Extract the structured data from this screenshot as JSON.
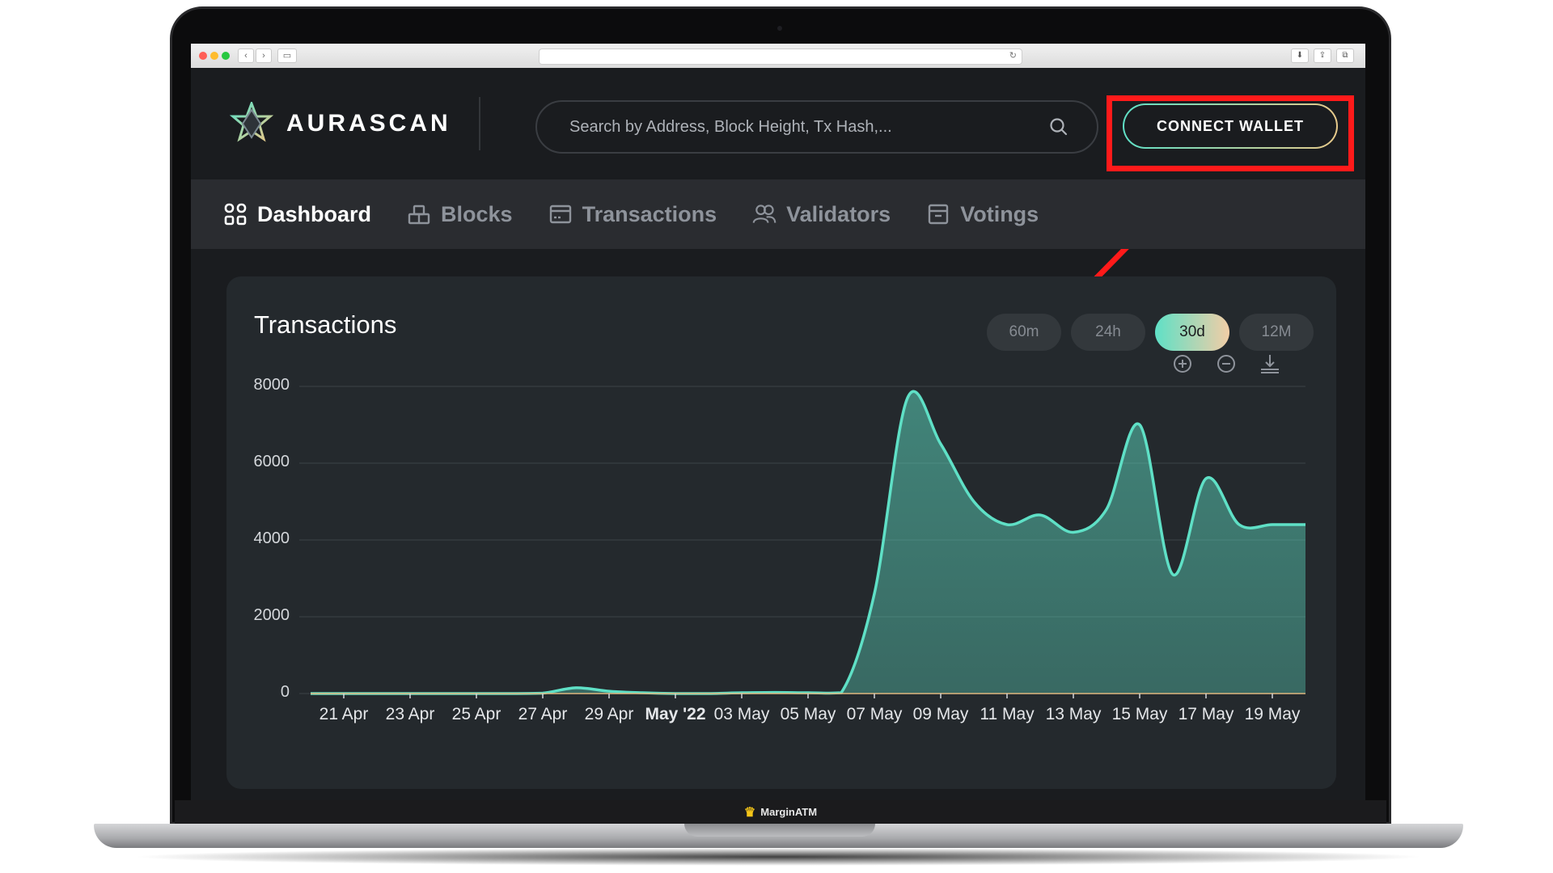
{
  "browser": {},
  "header": {
    "logo_text": "AURASCAN",
    "search_placeholder": "Search by Address, Block Height, Tx Hash,...",
    "connect_label": "CONNECT WALLET"
  },
  "nav": {
    "items": [
      {
        "label": "Dashboard",
        "icon": "grid-icon",
        "active": true
      },
      {
        "label": "Blocks",
        "icon": "blocks-icon",
        "active": false
      },
      {
        "label": "Transactions",
        "icon": "transactions-icon",
        "active": false
      },
      {
        "label": "Validators",
        "icon": "users-icon",
        "active": false
      },
      {
        "label": "Votings",
        "icon": "votings-icon",
        "active": false
      }
    ]
  },
  "card": {
    "title": "Transactions",
    "ranges": [
      "60m",
      "24h",
      "30d",
      "12M"
    ],
    "active_range": "30d"
  },
  "bezel": {
    "brand": "MarginATM"
  },
  "colors": {
    "accent": "#5fe0c6",
    "accent_gold": "#e7c98a",
    "highlight": "#ff1a1a",
    "background": "#1a1c1f",
    "card": "#24292d"
  },
  "chart_data": {
    "type": "area",
    "title": "",
    "xlabel": "",
    "ylabel": "",
    "ylim": [
      0,
      8000
    ],
    "yticks": [
      0,
      2000,
      4000,
      6000,
      8000
    ],
    "xticks": [
      "21 Apr",
      "23 Apr",
      "25 Apr",
      "27 Apr",
      "29 Apr",
      "May '22",
      "03 May",
      "05 May",
      "07 May",
      "09 May",
      "11 May",
      "13 May",
      "15 May",
      "17 May",
      "19 May"
    ],
    "xtick_bold": "May '22",
    "grid": true,
    "series": [
      {
        "x": [
          "20 Apr",
          "21 Apr",
          "22 Apr",
          "23 Apr",
          "24 Apr",
          "25 Apr",
          "26 Apr",
          "27 Apr",
          "28 Apr",
          "29 Apr",
          "30 Apr",
          "1 May",
          "2 May",
          "3 May",
          "4 May",
          "5 May",
          "6 May",
          "7 May",
          "8 May",
          "9 May",
          "10 May",
          "11 May",
          "12 May",
          "13 May",
          "14 May",
          "15 May",
          "16 May",
          "17 May",
          "18 May",
          "19 May",
          "20 May"
        ],
        "values": [
          0,
          0,
          0,
          0,
          0,
          0,
          0,
          10,
          150,
          60,
          20,
          0,
          0,
          20,
          30,
          20,
          20,
          2600,
          7700,
          6500,
          5000,
          4400,
          4650,
          4200,
          4800,
          7000,
          3100,
          5600,
          4400,
          4400,
          4400
        ]
      }
    ]
  }
}
